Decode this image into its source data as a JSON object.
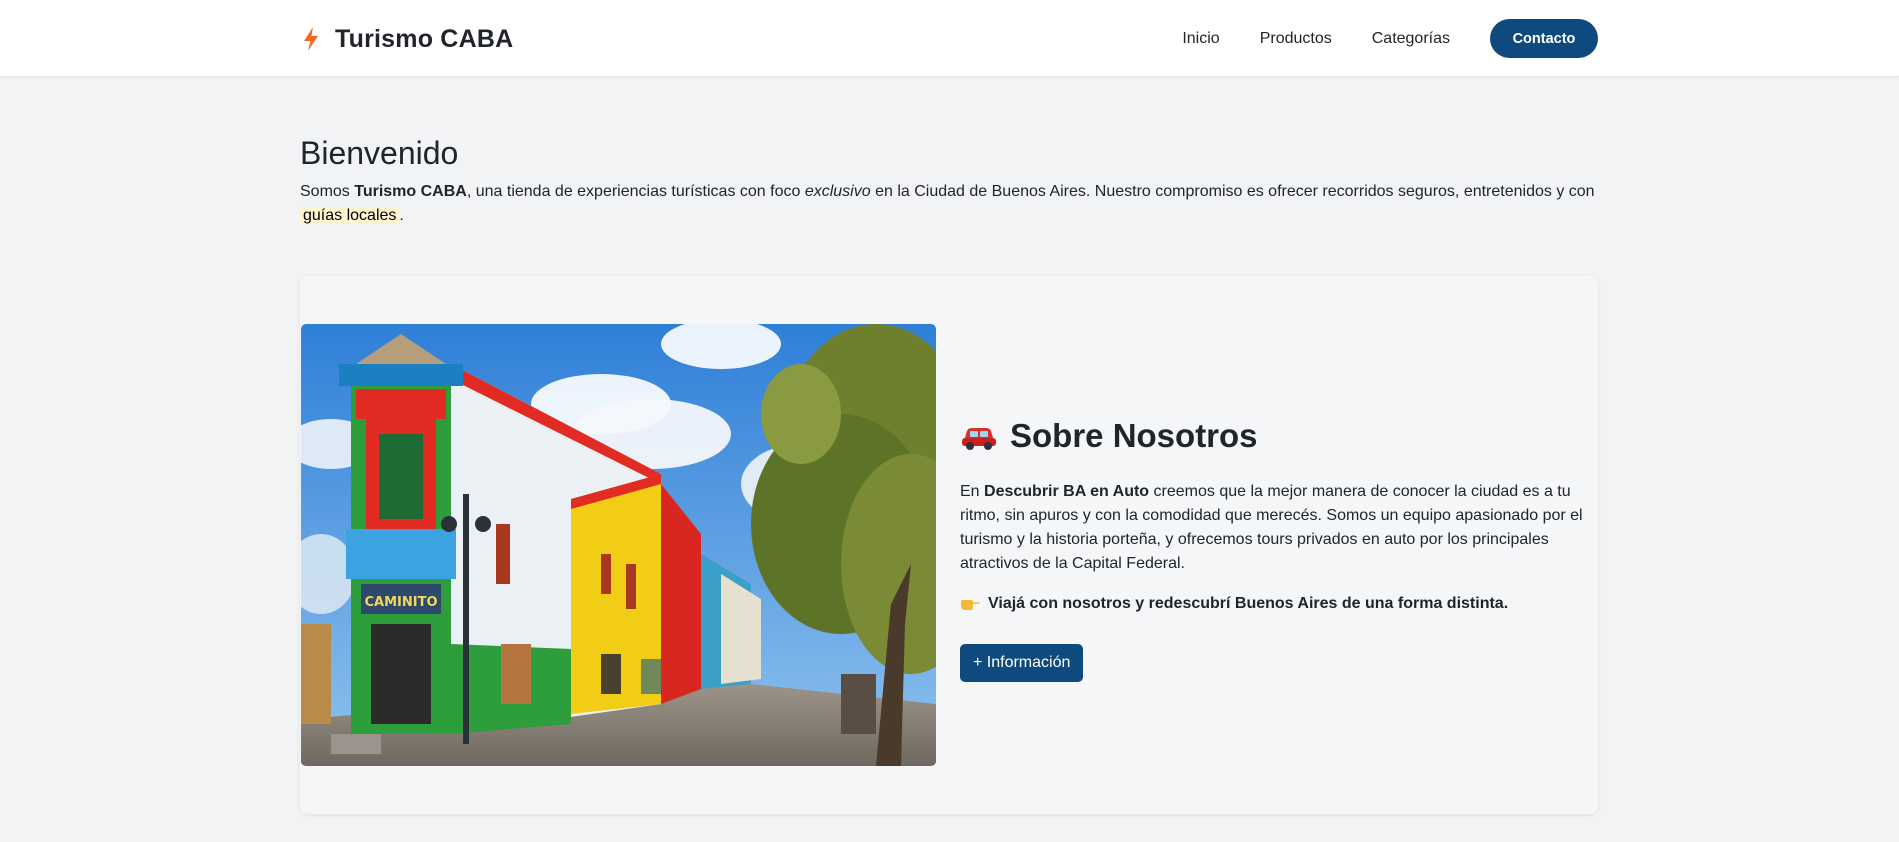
{
  "nav": {
    "brand": "Turismo CABA",
    "links": [
      "Inicio",
      "Productos",
      "Categorías"
    ],
    "cta": "Contacto"
  },
  "welcome": {
    "title": "Bienvenido",
    "p_before": "Somos ",
    "p_strong": "Turismo CABA",
    "p_mid": ", una tienda de experiencias turísticas con foco ",
    "p_em": "exclusivo",
    "p_after": " en la Ciudad de Buenos Aires. Nuestro compromiso es ofrecer recorridos seguros, entretenidos y con ",
    "p_highlight": "guías locales",
    "p_end": "."
  },
  "about": {
    "image_sign": "CAMINITO",
    "title": "Sobre Nosotros",
    "p_before": "En ",
    "p_strong": "Descubrir BA en Auto",
    "p_after": " creemos que la mejor manera de conocer la ciudad es a tu ritmo, sin apuros y con la comodidad que merecés. Somos un equipo apasionado por el turismo y la historia porteña, y ofrecemos tours privados en auto por los principales atractivos de la Capital Federal.",
    "tagline": "Viajá con nosotros y redescubrí Buenos Aires de una forma distinta.",
    "button": "+ Información"
  },
  "icons": {
    "brand": "lightning-icon",
    "about": "car-icon",
    "tagline": "pointing-hand-icon"
  },
  "colors": {
    "primary": "#0e4a7d",
    "background": "#f2f3f5",
    "highlight": "#fff3cd",
    "lightning": "#f26b21"
  }
}
